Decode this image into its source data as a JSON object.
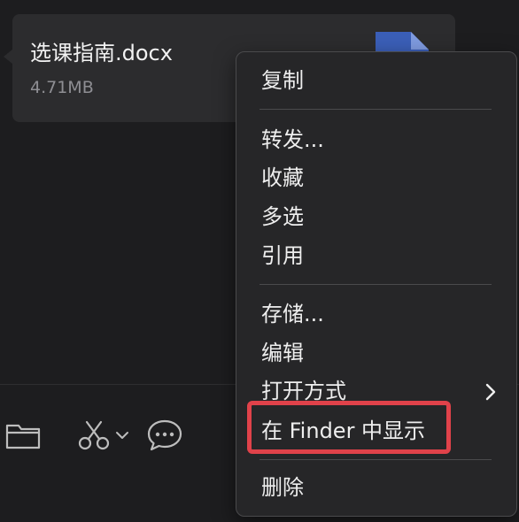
{
  "file": {
    "name": "选课指南.docx",
    "size": "4.71MB",
    "icon": "word-document-icon"
  },
  "toolbar": {
    "icons": [
      "folder-icon",
      "scissors-icon",
      "chevron-down-icon",
      "chat-bubble-icon"
    ]
  },
  "context_menu": {
    "copy": "复制",
    "forward": "转发...",
    "favorite": "收藏",
    "multi_select": "多选",
    "quote": "引用",
    "save": "存储...",
    "edit": "编辑",
    "open_with": "打开方式",
    "show_in_finder": "在 Finder 中显示",
    "delete": "删除"
  },
  "colors": {
    "background": "#1d1d1f",
    "bubble": "#2c2c2e",
    "menu": "#262628",
    "highlight": "#e0424a",
    "doc_icon": "#3b5fb8"
  }
}
